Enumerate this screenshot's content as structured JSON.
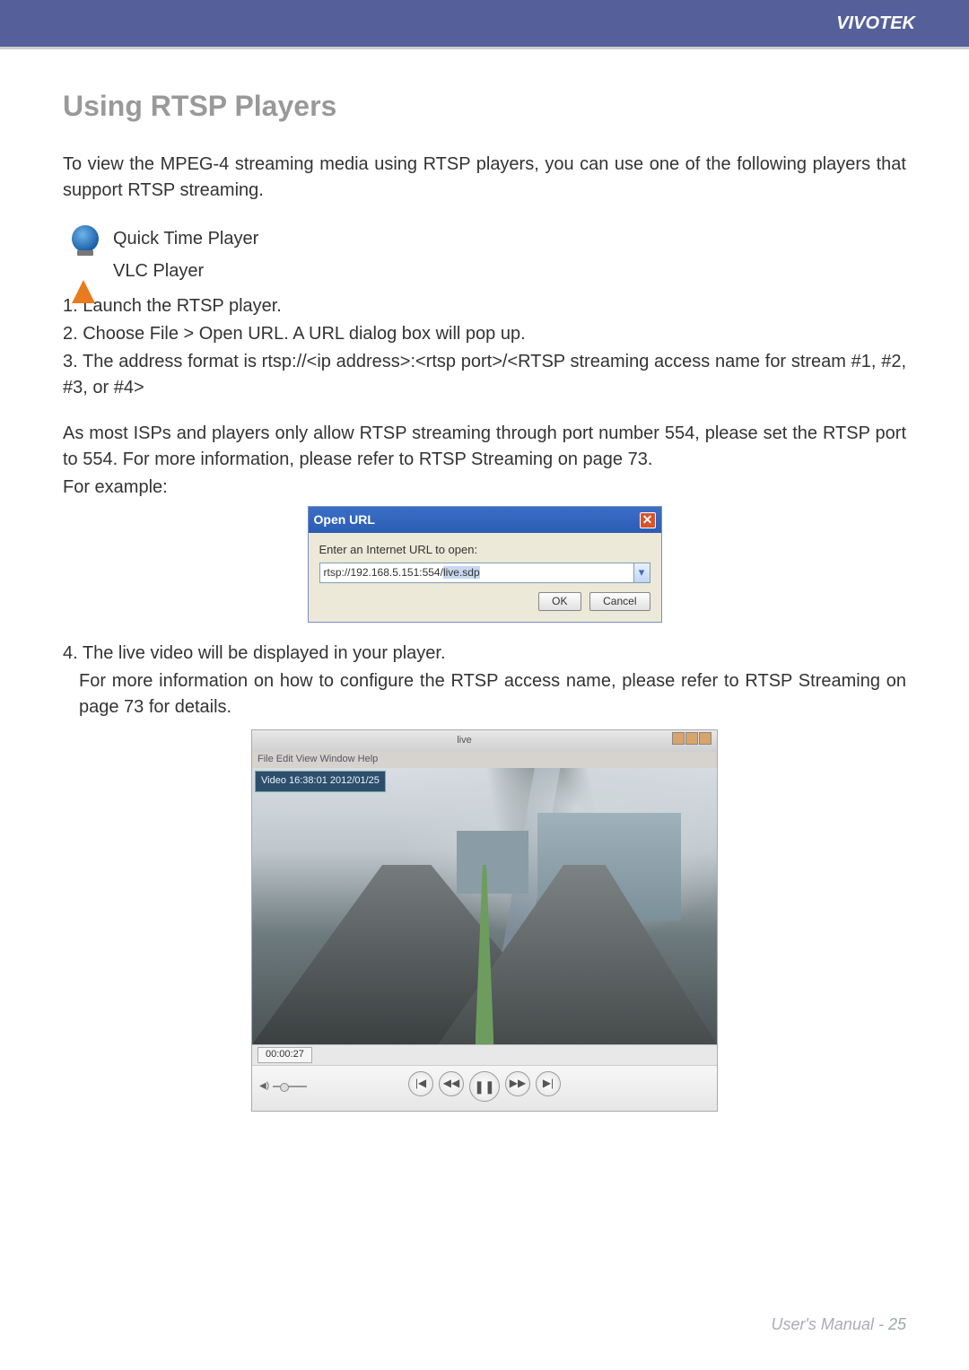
{
  "header": {
    "brand": "VIVOTEK"
  },
  "section": {
    "title": "Using RTSP Players"
  },
  "paragraphs": {
    "intro": "To view the MPEG-4 streaming media using RTSP players, you can use one of the following players that support RTSP streaming.",
    "players": {
      "quicktime": "Quick Time Player",
      "vlc": "VLC Player"
    },
    "steps": {
      "s1": "1. Launch the RTSP player.",
      "s2": "2. Choose File > Open URL. A URL dialog box will pop up.",
      "s3": "3. The address format is rtsp://<ip address>:<rtsp port>/<RTSP streaming access name for stream #1, #2, #3, or #4>",
      "note": "As most ISPs and players only allow RTSP streaming through port number 554, please set the RTSP port to 554. For more information, please refer to RTSP Streaming on page 73.",
      "example_label": "For example:",
      "s4": "4. The live video will be displayed in your player.",
      "s4b": "For more information on how to configure the RTSP access name, please refer to RTSP Streaming on page 73 for details."
    }
  },
  "dialog": {
    "title": "Open URL",
    "label": "Enter an Internet URL to open:",
    "value_prefix": "rtsp://192.168.5.151:554/",
    "value_hl": "live.sdp",
    "ok": "OK",
    "cancel": "Cancel"
  },
  "player_window": {
    "title": "live",
    "menu": "File   Edit   View   Window   Help",
    "overlay": "Video 16:38:01 2012/01/25",
    "elapsed": "00:00:27"
  },
  "footer": {
    "label": "User's Manual - ",
    "page": "25"
  }
}
